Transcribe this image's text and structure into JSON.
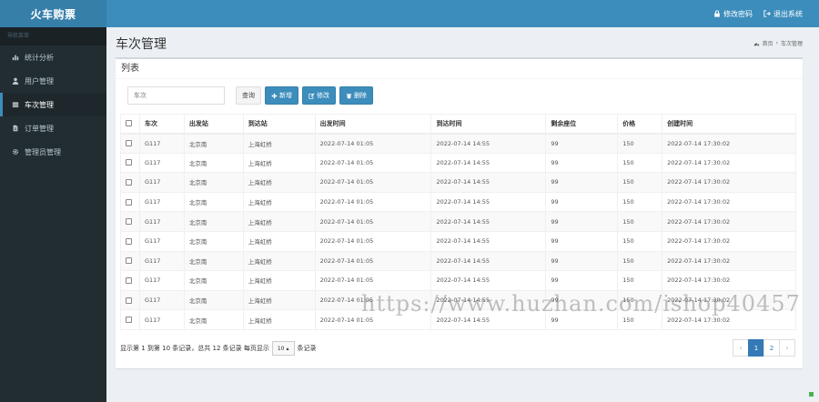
{
  "app": {
    "title": "火车购票"
  },
  "header": {
    "change_password": "修改密码",
    "logout": "退出系统"
  },
  "sidebar": {
    "header": "导航菜单",
    "items": [
      {
        "label": "统计分析",
        "icon": "bar-chart-icon"
      },
      {
        "label": "用户管理",
        "icon": "user-icon"
      },
      {
        "label": "车次管理",
        "icon": "list-icon"
      },
      {
        "label": "订单管理",
        "icon": "file-icon"
      },
      {
        "label": "管理员管理",
        "icon": "gear-icon"
      }
    ],
    "active_index": 2
  },
  "page": {
    "title": "车次管理",
    "breadcrumb": {
      "home": "首页",
      "sep": "›",
      "current": "车次管理"
    }
  },
  "box": {
    "title": "列表"
  },
  "toolbar": {
    "search_placeholder": "车次",
    "query_label": "查询",
    "add_label": "新增",
    "edit_label": "修改",
    "delete_label": "删除"
  },
  "table": {
    "headers": [
      "车次",
      "出发站",
      "到达站",
      "出发时间",
      "到达时间",
      "剩余座位",
      "价格",
      "创建时间"
    ],
    "rows": [
      [
        "G117",
        "北京南",
        "上海虹桥",
        "2022-07-14 01:05",
        "2022-07-14 14:55",
        "99",
        "150",
        "2022-07-14 17:30:02"
      ],
      [
        "G117",
        "北京南",
        "上海虹桥",
        "2022-07-14 01:05",
        "2022-07-14 14:55",
        "99",
        "150",
        "2022-07-14 17:30:02"
      ],
      [
        "G117",
        "北京南",
        "上海虹桥",
        "2022-07-14 01:05",
        "2022-07-14 14:55",
        "99",
        "150",
        "2022-07-14 17:30:02"
      ],
      [
        "G117",
        "北京南",
        "上海虹桥",
        "2022-07-14 01:05",
        "2022-07-14 14:55",
        "99",
        "150",
        "2022-07-14 17:30:02"
      ],
      [
        "G117",
        "北京南",
        "上海虹桥",
        "2022-07-14 01:05",
        "2022-07-14 14:55",
        "99",
        "150",
        "2022-07-14 17:30:02"
      ],
      [
        "G117",
        "北京南",
        "上海虹桥",
        "2022-07-14 01:05",
        "2022-07-14 14:55",
        "99",
        "150",
        "2022-07-14 17:30:02"
      ],
      [
        "G117",
        "北京南",
        "上海虹桥",
        "2022-07-14 01:05",
        "2022-07-14 14:55",
        "99",
        "150",
        "2022-07-14 17:30:02"
      ],
      [
        "G117",
        "北京南",
        "上海虹桥",
        "2022-07-14 01:05",
        "2022-07-14 14:55",
        "99",
        "150",
        "2022-07-14 17:30:02"
      ],
      [
        "G117",
        "北京南",
        "上海虹桥",
        "2022-07-14 01:05",
        "2022-07-14 14:55",
        "99",
        "150",
        "2022-07-14 17:30:02"
      ],
      [
        "G117",
        "北京南",
        "上海虹桥",
        "2022-07-14 01:05",
        "2022-07-14 14:55",
        "99",
        "150",
        "2022-07-14 17:30:02"
      ]
    ]
  },
  "pagination_info": {
    "text": "显示第 1 到第 10 条记录，总共 12 条记录 每页显示",
    "page_size": "10",
    "suffix": "条记录"
  },
  "pagination": {
    "prev": "‹",
    "pages": [
      "1",
      "2"
    ],
    "next": "›",
    "active": "1"
  },
  "watermark": "https://www.huzhan.com/ishop40457",
  "colors": {
    "header": "#3c8dbc",
    "logo_bg": "#367fa9",
    "sidebar": "#222d32",
    "primary": "#3c8dbc",
    "page_active": "#337ab7"
  }
}
